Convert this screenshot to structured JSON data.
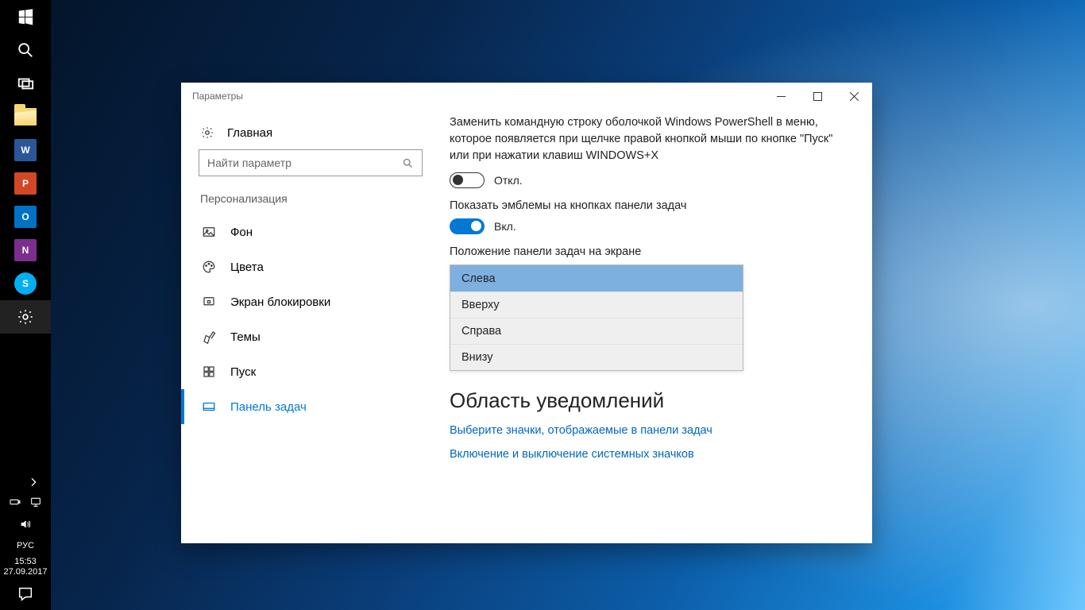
{
  "taskbar": {
    "system_buttons": [
      {
        "name": "start-button",
        "icon": "windows-icon"
      },
      {
        "name": "search-button",
        "icon": "search-icon"
      },
      {
        "name": "task-view-button",
        "icon": "task-view-icon"
      }
    ],
    "apps": [
      {
        "name": "file-explorer",
        "icon": "folder-icon"
      },
      {
        "name": "word",
        "letter": "W",
        "class": "ic-word"
      },
      {
        "name": "powerpoint",
        "letter": "P",
        "class": "ic-ppt"
      },
      {
        "name": "outlook",
        "letter": "O",
        "class": "ic-outlook"
      },
      {
        "name": "onenote",
        "letter": "N",
        "class": "ic-onenote"
      },
      {
        "name": "skype",
        "letter": "S",
        "class": "ic-skype"
      },
      {
        "name": "settings",
        "icon": "gear-icon",
        "active": true
      }
    ],
    "tray": {
      "icons": [
        "chevron-up-icon",
        "battery-icon",
        "network-icon",
        "volume-icon"
      ],
      "lang": "РУС",
      "time": "15:53",
      "date": "27.09.2017"
    }
  },
  "window": {
    "title": "Параметры",
    "sidebar": {
      "home_label": "Главная",
      "search_placeholder": "Найти параметр",
      "section_title": "Персонализация",
      "items": [
        {
          "label": "Фон"
        },
        {
          "label": "Цвета"
        },
        {
          "label": "Экран блокировки"
        },
        {
          "label": "Темы"
        },
        {
          "label": "Пуск"
        },
        {
          "label": "Панель задач",
          "active": true
        }
      ]
    },
    "content": {
      "powershell_desc": "Заменить командную строку оболочкой Windows PowerShell в меню, которое появляется при щелчке правой кнопкой мыши по кнопке \"Пуск\" или при нажатии клавиш WINDOWS+X",
      "toggle_off_label": "Откл.",
      "badges_label": "Показать эмблемы на кнопках панели задач",
      "toggle_on_label": "Вкл.",
      "position_label": "Положение панели задач на экране",
      "position_options": [
        "Слева",
        "Вверху",
        "Справа",
        "Внизу"
      ],
      "position_selected": "Слева",
      "notif_heading": "Область уведомлений",
      "link_select_icons": "Выберите значки, отображаемые в панели задач",
      "link_system_icons": "Включение и выключение системных значков"
    }
  }
}
